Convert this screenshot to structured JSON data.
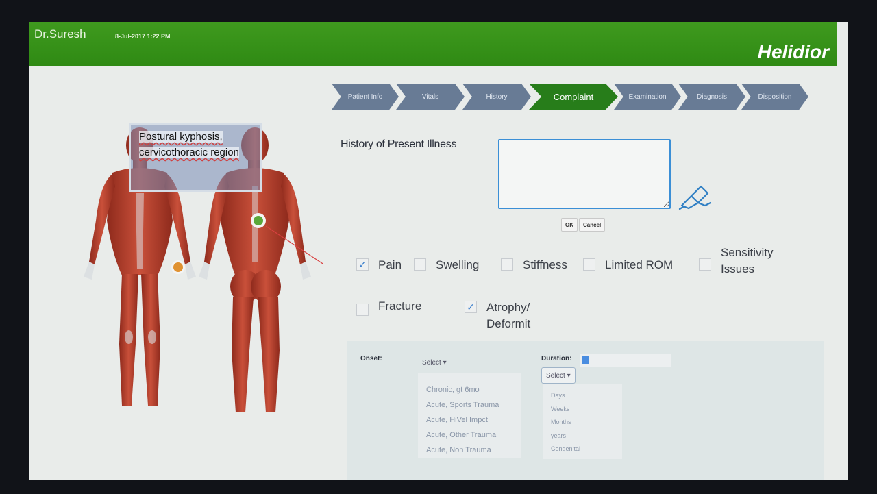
{
  "header": {
    "user": "Dr.Suresh",
    "datetime": "8-Jul-2017 1:22 PM",
    "brand": "Helidior",
    "accent_color": "#2f8a14"
  },
  "steps": [
    {
      "label": "Patient Info",
      "active": false
    },
    {
      "label": "Vitals",
      "active": false
    },
    {
      "label": "History",
      "active": false
    },
    {
      "label": "Complaint",
      "active": true
    },
    {
      "label": "Examination",
      "active": false
    },
    {
      "label": "Diagnosis",
      "active": false
    },
    {
      "label": "Disposition",
      "active": false
    }
  ],
  "hpi": {
    "label": "History of Present Illness",
    "value": "",
    "ok_label": "OK",
    "cancel_label": "Cancel",
    "pen_icon": "pen-write-icon"
  },
  "annotation": {
    "text": "Postural kyphosis, cervicothoracic region"
  },
  "symptoms": [
    {
      "label": "Pain",
      "checked": true
    },
    {
      "label": "Swelling",
      "checked": false
    },
    {
      "label": "Stiffness",
      "checked": false
    },
    {
      "label": "Limited ROM",
      "checked": false
    },
    {
      "label": "Sensitivity Issues",
      "checked": false
    },
    {
      "label": "Fracture",
      "checked": false
    },
    {
      "label": "Atrophy/ Deformit",
      "checked": true
    }
  ],
  "onset": {
    "label": "Onset:",
    "select_label": "Select ▾",
    "options": [
      "Chronic, gt 6mo",
      "Acute, Sports Trauma",
      "Acute, HiVel Impct",
      "Acute, Other Trauma",
      "Acute, Non Trauma"
    ]
  },
  "duration": {
    "label": "Duration:",
    "value": "",
    "select_label": "Select ▾",
    "options": [
      "Days",
      "Weeks",
      "Months",
      "years",
      "Congenital"
    ]
  }
}
